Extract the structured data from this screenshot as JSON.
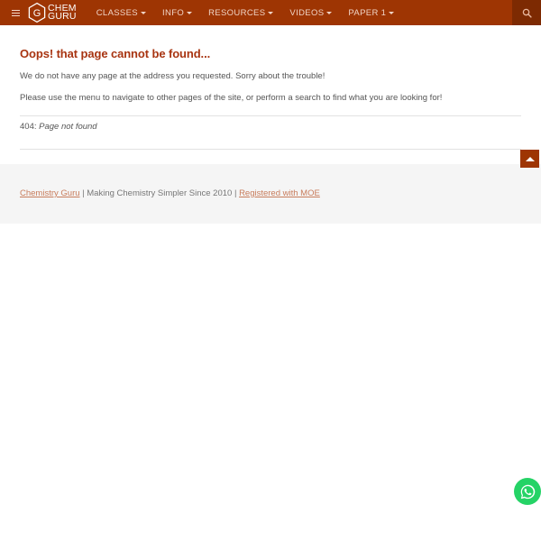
{
  "navbar": {
    "menu_icon": "hamburger-icon",
    "brand": {
      "line1": "CHEM",
      "line2": "GURU",
      "logo_icon": "hexagon-g-logo-icon"
    },
    "items": [
      {
        "label": "CLASSES",
        "has_dropdown": true
      },
      {
        "label": "INFO",
        "has_dropdown": true
      },
      {
        "label": "RESOURCES",
        "has_dropdown": true
      },
      {
        "label": "VIDEOS",
        "has_dropdown": true
      },
      {
        "label": "PAPER 1",
        "has_dropdown": true
      }
    ],
    "search_icon": "search-icon",
    "background_color": "#9e3503",
    "search_background_color": "#7d2a02"
  },
  "main": {
    "title": "Oops! that page cannot be found...",
    "paragraph1": "We do not have any page at the address you requested. Sorry about the trouble!",
    "paragraph2": "Please use the menu to navigate to other pages of the site, or perform a search to find what you are looking for!",
    "error_code": "404:",
    "error_text": "Page not found",
    "title_color": "#a83411"
  },
  "footer": {
    "link1": "Chemistry Guru",
    "separator1": " | ",
    "tagline": "Making Chemistry Simpler Since 2010",
    "separator2": " | ",
    "link2": "Registered with MOE",
    "link_color": "#c87c5c",
    "background_color": "#f5f5f5"
  },
  "floating": {
    "back_to_top_icon": "chevron-up-icon",
    "whatsapp_icon": "whatsapp-icon",
    "whatsapp_color": "#25d366"
  }
}
